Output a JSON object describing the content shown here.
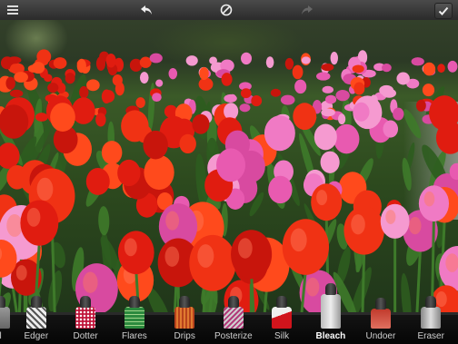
{
  "toolbar": {
    "menu_icon": "list-icon",
    "undo_icon": "undo-arrow-icon",
    "compare_icon": "circle-slash-icon",
    "redo_icon": "redo-arrow-icon",
    "confirm_icon": "checkmark-icon"
  },
  "tools": [
    {
      "label": "al",
      "active": false
    },
    {
      "label": "Edger",
      "active": false
    },
    {
      "label": "Dotter",
      "active": false
    },
    {
      "label": "Flares",
      "active": false
    },
    {
      "label": "Drips",
      "active": false
    },
    {
      "label": "Posterize",
      "active": false
    },
    {
      "label": "Silk",
      "active": false
    },
    {
      "label": "Bleach",
      "active": true
    },
    {
      "label": "Undoer",
      "active": false
    },
    {
      "label": "Eraser",
      "active": false
    }
  ],
  "colors": {
    "tulip_red": "#e01c10",
    "tulip_pink": "#e85ab0",
    "foliage": "#3e7a2a"
  }
}
